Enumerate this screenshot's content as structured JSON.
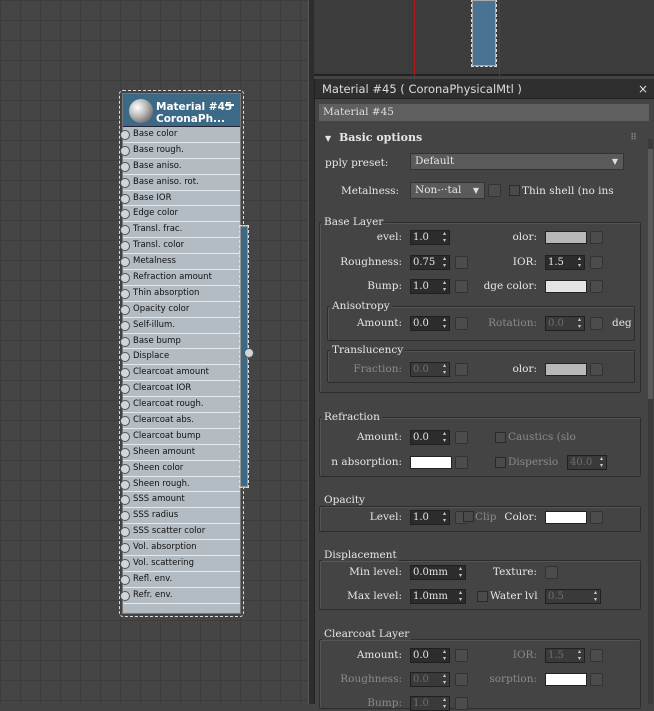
{
  "viewport": {},
  "node": {
    "title_line1": "Material #45",
    "title_line2": "CoronaPh...",
    "slots": [
      "Base color",
      "Base rough.",
      "Base aniso.",
      "Base aniso. rot.",
      "Base IOR",
      "Edge color",
      "Transl. frac.",
      "Transl. color",
      "Metalness",
      "Refraction amount",
      "Thin absorption",
      "Opacity color",
      "Self-illum.",
      "Base bump",
      "Displace",
      "Clearcoat amount",
      "Clearcoat IOR",
      "Clearcoat rough.",
      "Clearcoat abs.",
      "Clearcoat bump",
      "Sheen amount",
      "Sheen color",
      "Sheen rough.",
      "SSS amount",
      "SSS radius",
      "SSS scatter color",
      "Vol. absorption",
      "Vol. scattering",
      "Refl. env.",
      "Refr. env."
    ]
  },
  "panel": {
    "title": "Material #45  ( CoronaPhysicalMtl )",
    "close": "×",
    "material_name": "Material #45",
    "rollout_title": "Basic options",
    "apply_preset_label": "pply preset:",
    "apply_preset_value": "Default",
    "metalness_label": "Metalness:",
    "metalness_value": "Non-··tal",
    "thin_shell_label": "Thin shell (no ins",
    "base_layer": {
      "title": "Base Layer",
      "level_label": "evel:",
      "level_value": "1.0",
      "color_label": "olor:",
      "color_swatch": "#b8b8b8",
      "roughness_label": "Roughness:",
      "roughness_value": "0.75",
      "ior_label": "IOR:",
      "ior_value": "1.5",
      "bump_label": "Bump:",
      "bump_value": "1.0",
      "edge_color_label": "dge color:",
      "edge_color_swatch": "#e4e4e4",
      "anisotropy_title": "Anisotropy",
      "amount_label": "Amount:",
      "amount_value": "0.0",
      "rotation_label": "Rotation:",
      "rotation_value": "0.0",
      "deg": "deg",
      "translucency_title": "Translucency",
      "fraction_label": "Fraction:",
      "fraction_value": "0.0",
      "tcolor_label": "olor:",
      "tcolor_swatch": "#b8b8b8"
    },
    "refraction": {
      "title": "Refraction",
      "amount_label": "Amount:",
      "amount_value": "0.0",
      "caustics_label": "Caustics (slo",
      "absorption_label": "n absorption:",
      "absorption_swatch": "#ffffff",
      "dispersion_label": "Dispersio",
      "dispersion_value": "40.0"
    },
    "opacity": {
      "title": "Opacity",
      "level_label": "Level:",
      "level_value": "1.0",
      "clip_label": "Clip",
      "color_label": "Color:",
      "color_swatch": "#ffffff"
    },
    "displacement": {
      "title": "Displacement",
      "min_label": "Min level:",
      "min_value": "0.0mm",
      "texture_label": "Texture:",
      "max_label": "Max level:",
      "max_value": "1.0mm",
      "water_label": "Water lvl",
      "water_value": "0.5"
    },
    "clearcoat": {
      "title": "Clearcoat Layer",
      "amount_label": "Amount:",
      "amount_value": "0.0",
      "ior_label": "IOR:",
      "ior_value": "1.5",
      "roughness_label": "Roughness:",
      "roughness_value": "0.0",
      "absorption_label": "sorption:",
      "absorption_swatch": "#ffffff",
      "bump_label": "Bump:",
      "bump_value": "1.0"
    }
  }
}
